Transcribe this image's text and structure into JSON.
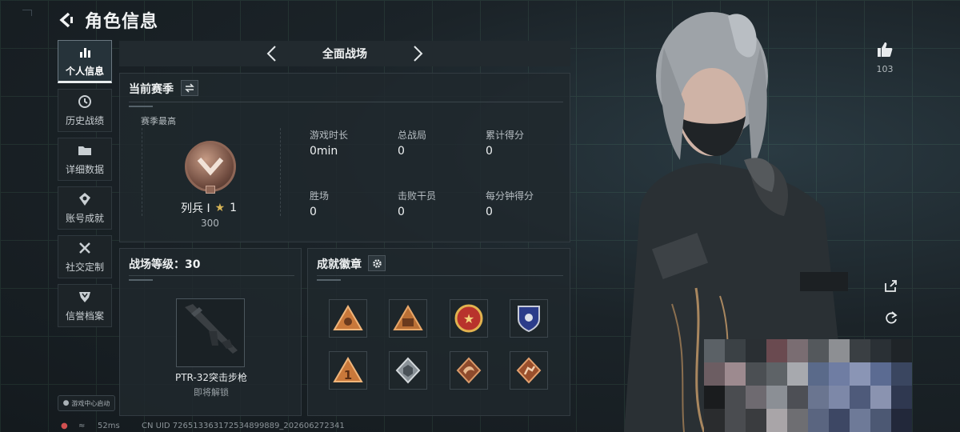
{
  "header": {
    "title": "角色信息"
  },
  "nav": [
    {
      "label": "个人信息",
      "icon": "bar-chart-icon",
      "active": true
    },
    {
      "label": "历史战绩",
      "icon": "clock-icon"
    },
    {
      "label": "详细数据",
      "icon": "folder-icon"
    },
    {
      "label": "账号成就",
      "icon": "medal-icon"
    },
    {
      "label": "社交定制",
      "icon": "tools-icon"
    },
    {
      "label": "信誉档案",
      "icon": "shield-icon"
    }
  ],
  "launch_label": "游戏中心启动",
  "mode": {
    "label": "全面战场"
  },
  "season": {
    "title": "当前赛季",
    "best_label": "赛季最高",
    "rank_name": "列兵 I",
    "rank_stars": "1",
    "rank_score": "300",
    "stats": [
      {
        "label": "游戏时长",
        "value": "0min"
      },
      {
        "label": "总战局",
        "value": "0"
      },
      {
        "label": "累计得分",
        "value": "0"
      },
      {
        "label": "胜场",
        "value": "0"
      },
      {
        "label": "击败干员",
        "value": "0"
      },
      {
        "label": "每分钟得分",
        "value": "0"
      }
    ]
  },
  "battle_level": {
    "title": "战场等级：30",
    "weapon_name": "PTR-32突击步枪",
    "weapon_status": "即将解锁"
  },
  "achievements": {
    "title": "成就徽章",
    "badges": [
      "triangle-soldiers-badge",
      "triangle-squad-badge",
      "star-emblem-badge",
      "police-shield-badge",
      "number-one-badge",
      "cube-badge",
      "dragon-badge",
      "runner-badge"
    ]
  },
  "likes": {
    "count": "103"
  },
  "footer": {
    "ping": "52ms",
    "uid": "CN UID 726513363172534899889_202606272341"
  },
  "colors": {
    "accent": "#eef1f2",
    "panel": "#20282d",
    "badge_orange": "#d98a3a"
  }
}
